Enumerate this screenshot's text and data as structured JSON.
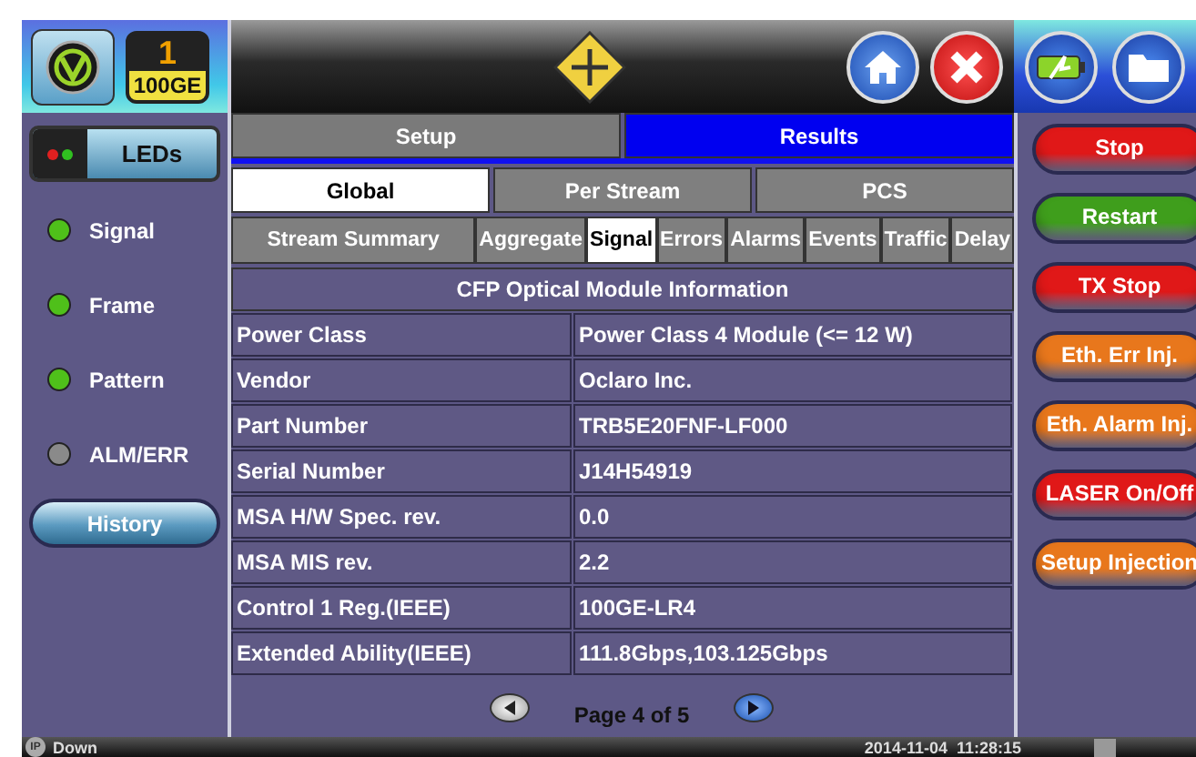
{
  "badge": {
    "number": "1",
    "label": "100GE"
  },
  "sidebar": {
    "leds_button": "LEDs",
    "leds": [
      {
        "label": "Signal",
        "color": "#4fc01a"
      },
      {
        "label": "Frame",
        "color": "#4fc01a"
      },
      {
        "label": "Pattern",
        "color": "#4fc01a"
      },
      {
        "label": "ALM/ERR",
        "color": "#8a8a8a"
      }
    ],
    "history_button": "History"
  },
  "main_tabs": [
    {
      "label": "Setup",
      "selected": false
    },
    {
      "label": "Results",
      "selected": true
    }
  ],
  "sub_tabs": [
    {
      "label": "Global",
      "selected": true
    },
    {
      "label": "Per Stream",
      "selected": false
    },
    {
      "label": "PCS",
      "selected": false
    }
  ],
  "section_tabs": [
    {
      "label": "Stream Summary",
      "selected": false
    },
    {
      "label": "Aggregate",
      "selected": false
    },
    {
      "label": "Signal",
      "selected": true
    },
    {
      "label": "Errors",
      "selected": false
    },
    {
      "label": "Alarms",
      "selected": false
    },
    {
      "label": "Events",
      "selected": false
    },
    {
      "label": "Traffic",
      "selected": false
    },
    {
      "label": "Delay",
      "selected": false
    }
  ],
  "table": {
    "title": "CFP Optical Module Information",
    "rows": [
      {
        "label": "Power Class",
        "value": "Power Class 4 Module (<= 12 W)"
      },
      {
        "label": "Vendor",
        "value": "Oclaro Inc."
      },
      {
        "label": "Part Number",
        "value": "TRB5E20FNF-LF000"
      },
      {
        "label": "Serial Number",
        "value": "J14H54919"
      },
      {
        "label": "MSA H/W Spec. rev.",
        "value": "0.0"
      },
      {
        "label": "MSA MIS rev.",
        "value": "2.2"
      },
      {
        "label": "Control 1 Reg.(IEEE)",
        "value": "100GE-LR4"
      },
      {
        "label": "Extended Ability(IEEE)",
        "value": "111.8Gbps,103.125Gbps"
      }
    ]
  },
  "pager": {
    "text": "Page 4 of 5"
  },
  "actions": [
    {
      "label": "Stop",
      "color": "#e01818"
    },
    {
      "label": "Restart",
      "color": "#3f9e1c"
    },
    {
      "label": "TX Stop",
      "color": "#e01818"
    },
    {
      "label": "Eth. Err Inj.",
      "color": "#e8771c"
    },
    {
      "label": "Eth. Alarm Inj.",
      "color": "#e8771c"
    },
    {
      "label": "LASER On/Off",
      "color": "#e01818"
    },
    {
      "label": "Setup Injection",
      "color": "#e8771c"
    }
  ],
  "status_bar": {
    "ip_badge": "IP",
    "link": "Down",
    "datetime": "2014-11-04  11:28:15"
  }
}
